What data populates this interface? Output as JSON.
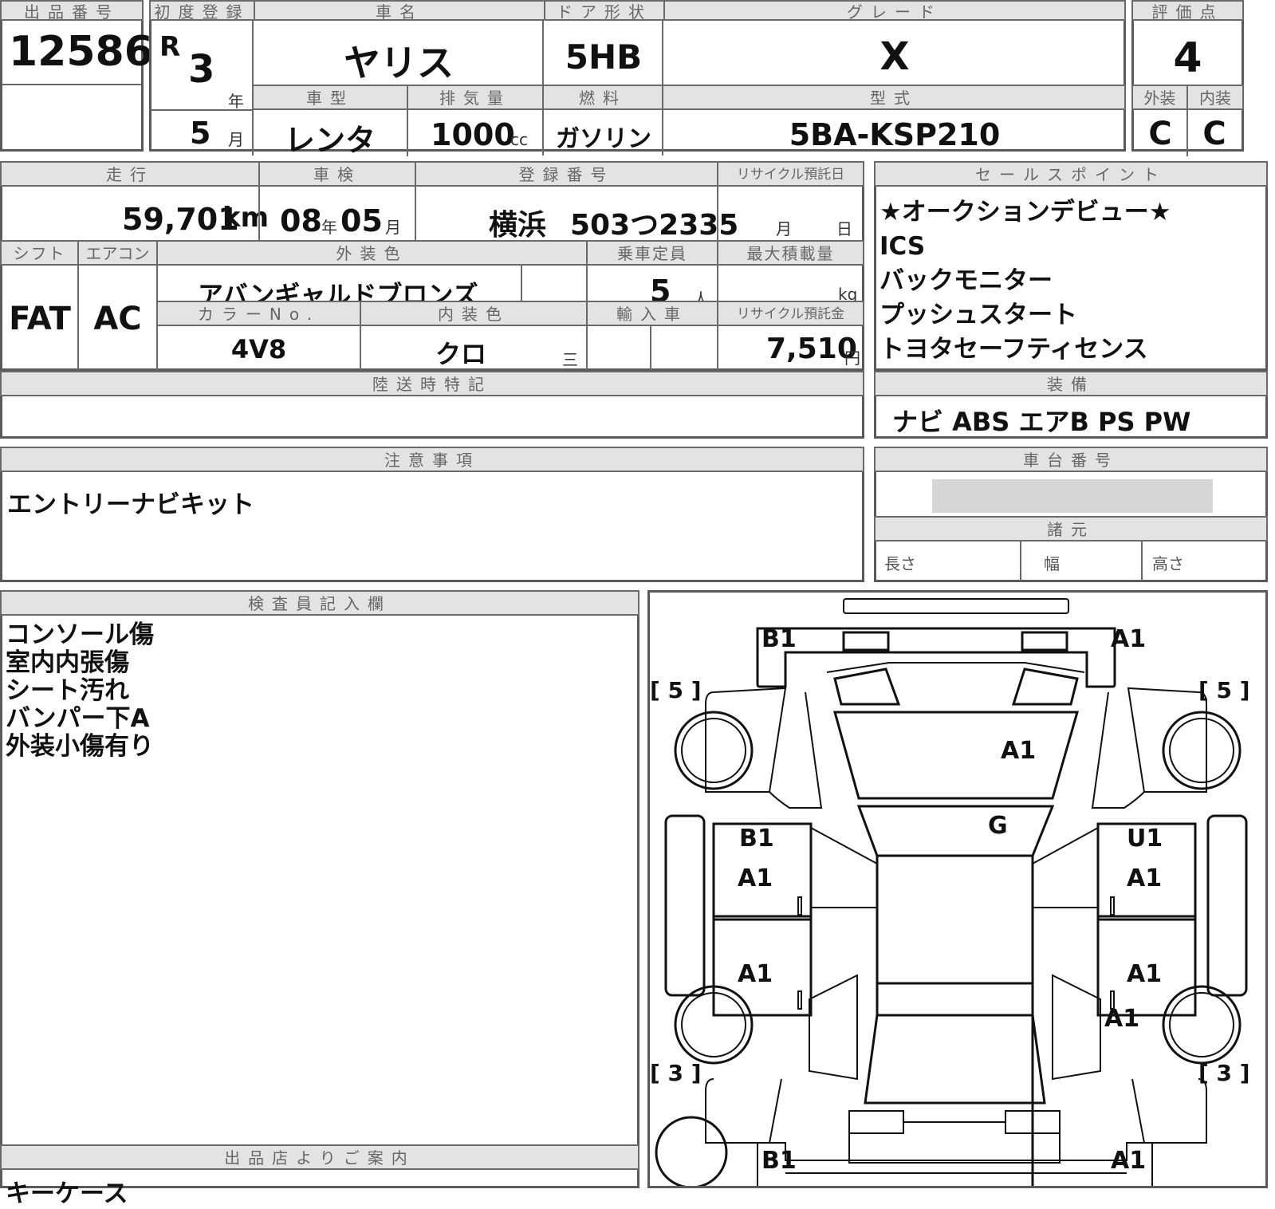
{
  "headers": {
    "lot": "出品番号",
    "first_reg": "初度登録",
    "car_name": "車名",
    "door": "ドア形状",
    "grade": "グレード",
    "score": "評価点",
    "body_type": "車型",
    "displacement": "排気量",
    "fuel": "燃料",
    "model_code": "型式",
    "exterior": "外装",
    "interior": "内装",
    "mileage": "走行",
    "inspection": "車検",
    "reg_no": "登録番号",
    "recycle_date": "リサイクル預託日",
    "sales_point": "セールスポイント",
    "shift": "シフト",
    "aircon": "エアコン",
    "ext_color": "外装色",
    "capacity": "乗車定員",
    "max_load": "最大積載量",
    "color_no": "カラーNo.",
    "int_color": "内装色",
    "import": "輸入車",
    "recycle_fee": "リサイクル預託金",
    "transport": "陸送時特記",
    "equipment": "装備",
    "notes": "注意事項",
    "chassis_no": "車台番号",
    "dimensions": "諸元",
    "inspector": "検査員記入欄",
    "seller_info": "出品店よりご案内"
  },
  "vehicle": {
    "lot_no": "12586",
    "era": "R",
    "year": "3",
    "year_unit": "年",
    "month": "5",
    "month_unit": "月",
    "name": "ヤリス",
    "door": "5HB",
    "grade": "X",
    "score": "4",
    "body_type": "レンタ",
    "displacement": "1000",
    "displacement_unit": "cc",
    "fuel": "ガソリン",
    "model_code": "5BA-KSP210",
    "exterior_grade": "C",
    "interior_grade": "C"
  },
  "specs": {
    "mileage": "59,701",
    "mileage_unit": "km",
    "inspection_year": "08",
    "inspection_year_unit": "年",
    "inspection_month": "05",
    "inspection_month_unit": "月",
    "reg_city": "横浜",
    "reg_number": "503つ2335",
    "recycle_month_unit": "月",
    "recycle_day_unit": "日",
    "shift": "FAT",
    "aircon": "AC",
    "ext_color": "アバンギャルドブロンズ",
    "capacity": "5",
    "capacity_unit": "人",
    "load_unit": "kg",
    "color_no": "4V8",
    "int_color": "クロ",
    "int_mark": "三",
    "recycle_fee": "7,510",
    "recycle_fee_unit": "円"
  },
  "sales_points": [
    "★オークションデビュー★",
    "ICS",
    "バックモニター",
    "プッシュスタート",
    "トヨタセーフティセンス"
  ],
  "equipment": "ナビ ABS エアB PS PW",
  "notes": "エントリーナビキット",
  "dimensions": {
    "length": "長さ",
    "width": "幅",
    "height": "高さ"
  },
  "inspector_notes": [
    "コンソール傷",
    "室内内張傷",
    "シート汚れ",
    "バンパー下A",
    "外装小傷有り"
  ],
  "seller_notes": "キーケース",
  "diagram": {
    "tire_fl": "[ 5 ]",
    "tire_fr": "[ 5 ]",
    "tire_rl": "[ 3 ]",
    "tire_rr": "[ 3 ]",
    "front_bumper_left": "B1",
    "front_bumper_right": "A1",
    "hood": "A1",
    "windshield": "G",
    "left_front_door_upper": "B1",
    "left_front_door_lower": "A1",
    "right_front_door_upper": "U1",
    "right_front_door_lower": "A1",
    "left_rear_door": "A1",
    "right_rear_door": "A1",
    "right_rear_fender": "A1",
    "rear_bumper_left": "B1",
    "rear_bumper_right": "A1"
  }
}
